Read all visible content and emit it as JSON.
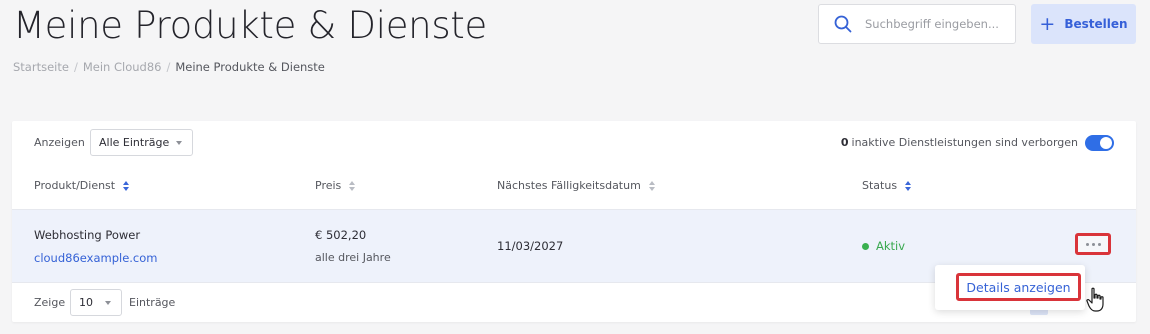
{
  "header": {
    "title": "Meine Produkte & Dienste",
    "breadcrumb": [
      "Startseite",
      "Mein Cloud86",
      "Meine Produkte & Dienste"
    ],
    "search": {
      "placeholder": "Suchbegriff eingeben...",
      "icon": "search-icon"
    },
    "order_button": {
      "label": "Bestellen",
      "icon": "plus-icon"
    }
  },
  "table_controls": {
    "show_label": "Anzeigen",
    "filter_value": "Alle Einträge",
    "inactive_count": "0",
    "inactive_text": "inaktive Dienstleistungen sind verborgen",
    "toggle_on": true
  },
  "columns": [
    {
      "label": "Produkt/Dienst",
      "sort_active": true
    },
    {
      "label": "Preis",
      "sort_active": false
    },
    {
      "label": "Nächstes Fälligkeitsdatum",
      "sort_active": false
    },
    {
      "label": "Status",
      "sort_active": true
    }
  ],
  "rows": [
    {
      "product": "Webhosting Power",
      "domain": "cloud86example.com",
      "price": "€ 502,20",
      "cycle": "alle drei Jahre",
      "due_date": "11/03/2027",
      "status": "Aktiv"
    }
  ],
  "footer": {
    "show_label": "Zeige",
    "page_size": "10",
    "entries_label": "Einträge"
  },
  "dropdown": {
    "item_label": "Details anzeigen"
  },
  "colors": {
    "accent": "#3562d6",
    "status_active": "#39a94f",
    "highlight_red": "#d9343a",
    "toggle": "#2f6ee6"
  }
}
